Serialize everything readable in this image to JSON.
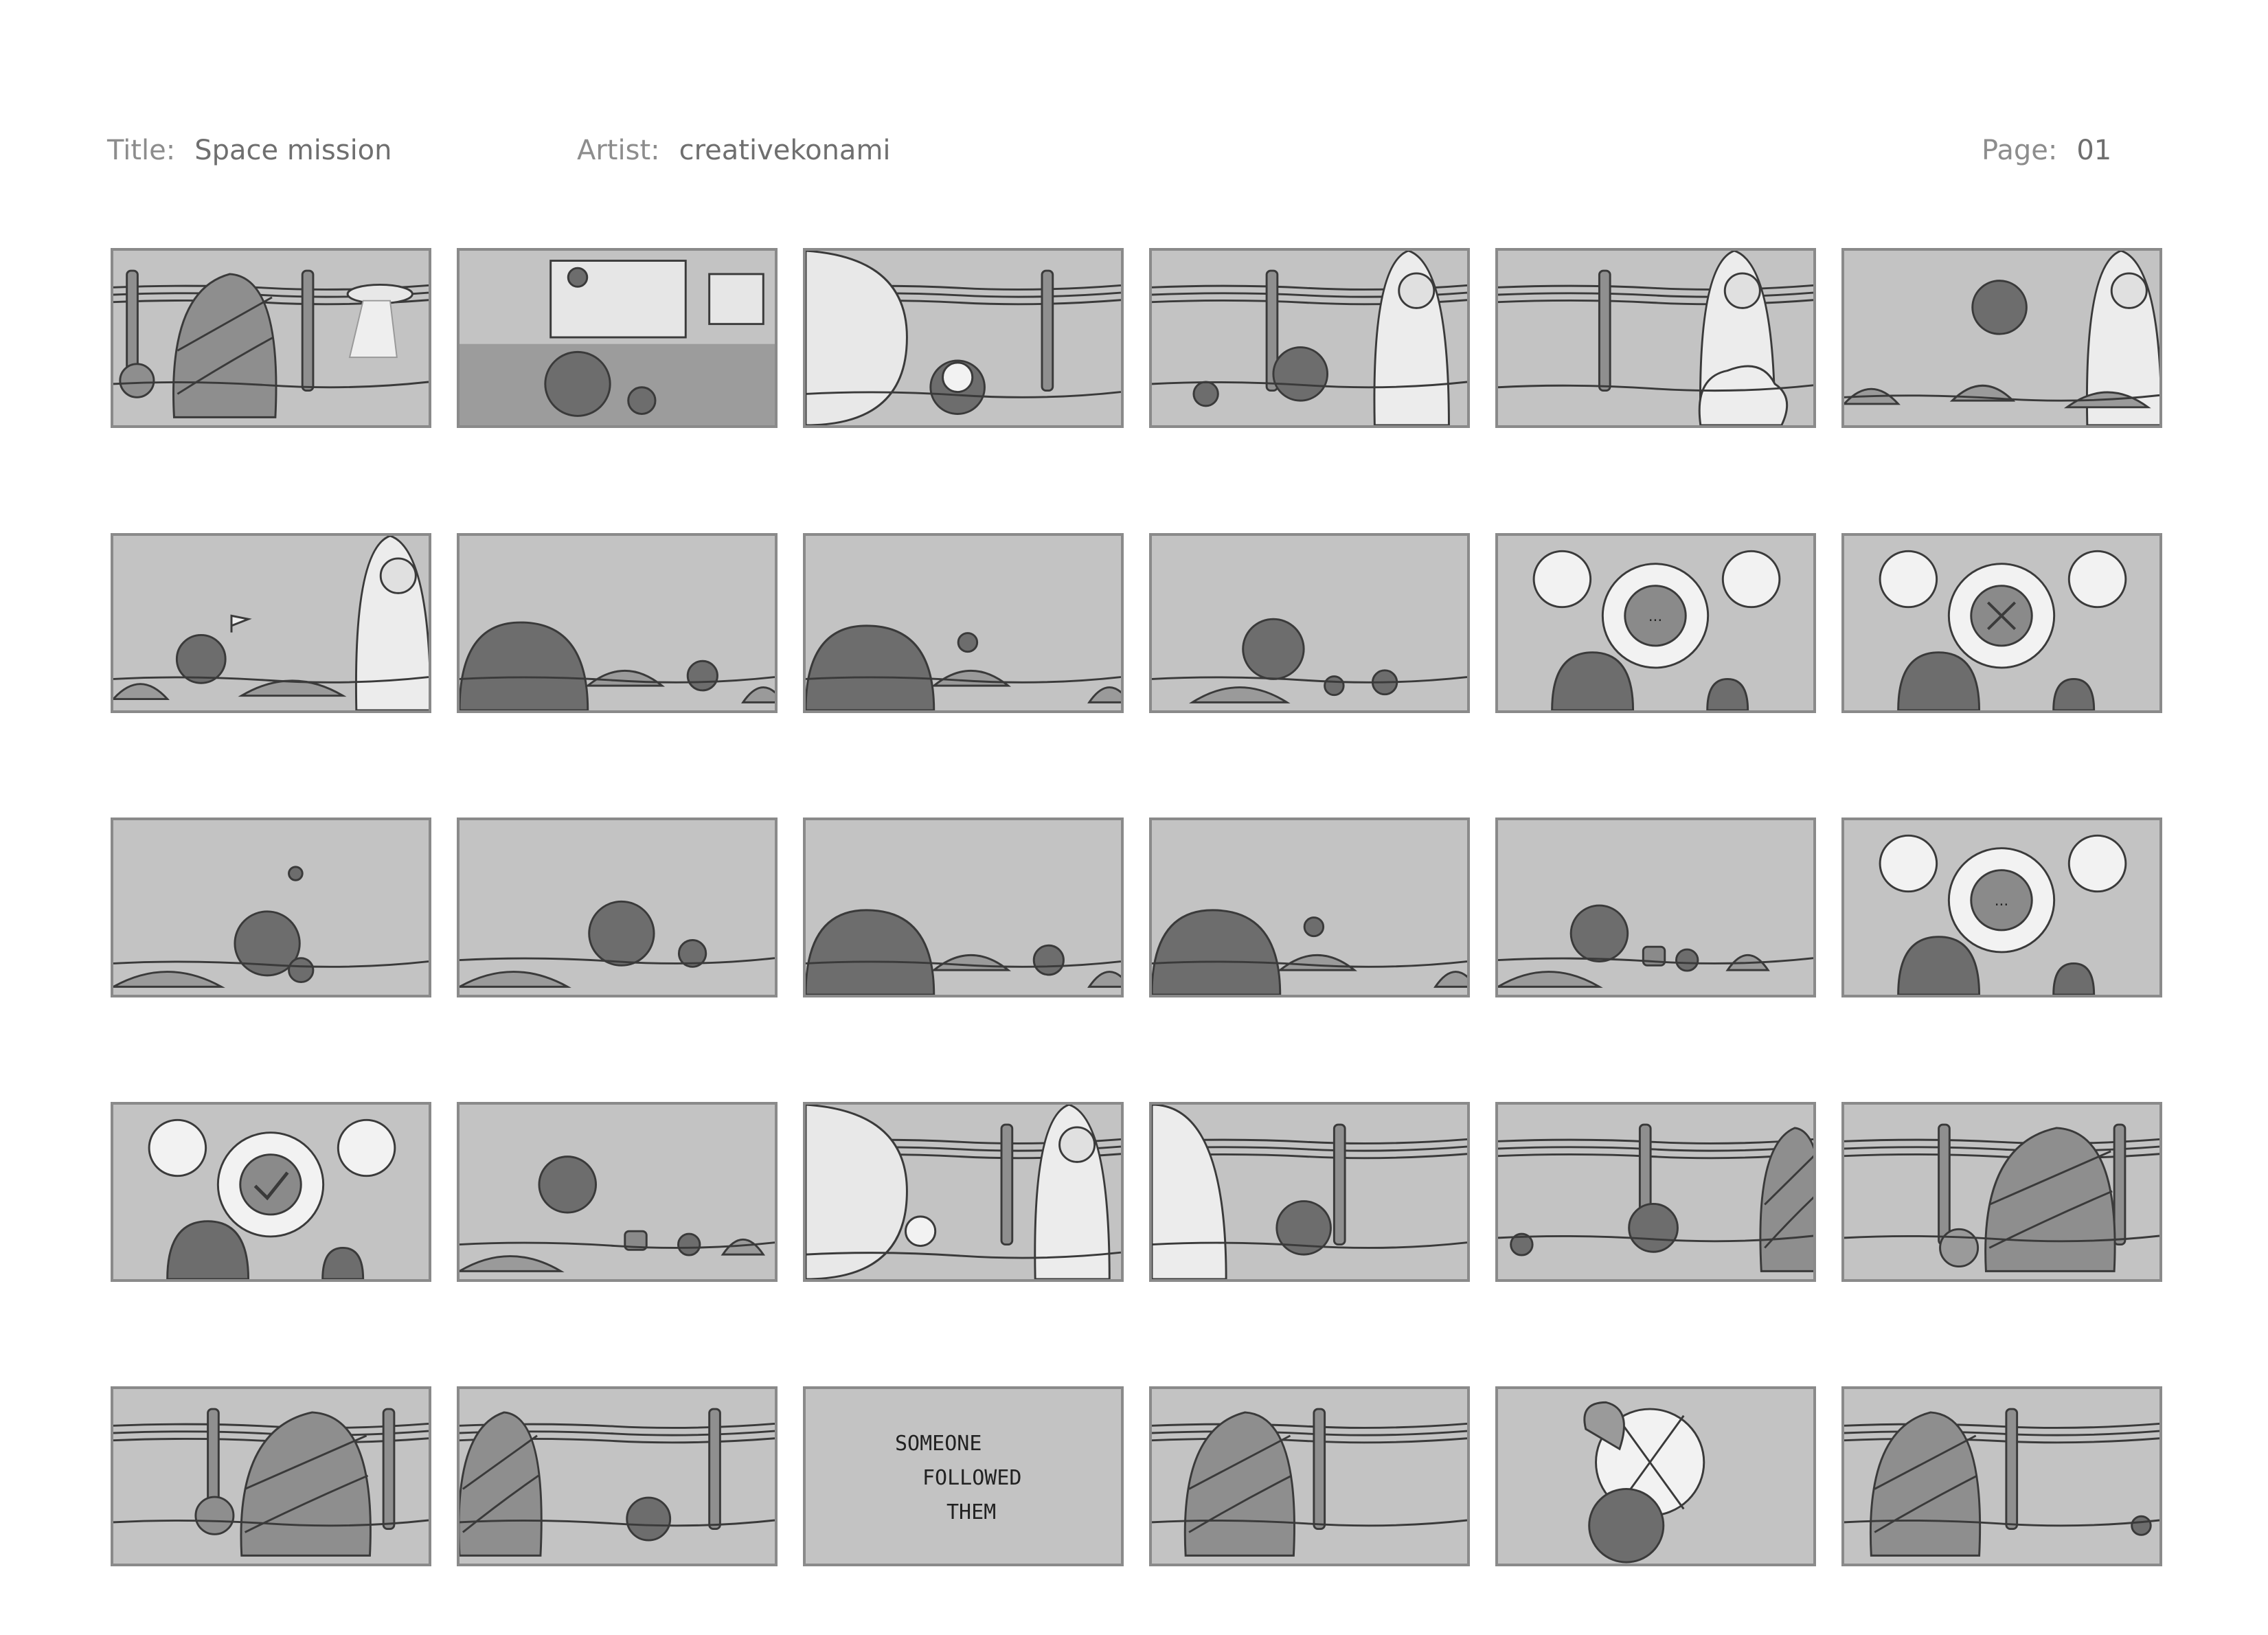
{
  "header": {
    "title_label": "Title:",
    "title_value": "Space mission",
    "artist_label": "Artist:",
    "artist_value": "creativekonami",
    "page_label": "Page:",
    "page_value": "01"
  },
  "panels": [
    {
      "scene": "rock-ufo"
    },
    {
      "scene": "room-tv"
    },
    {
      "scene": "dome-sign"
    },
    {
      "scene": "rocket-fence"
    },
    {
      "scene": "launch-smoke"
    },
    {
      "scene": "floating-character"
    },
    {
      "scene": "flag-planting"
    },
    {
      "scene": "big-creature-closeup"
    },
    {
      "scene": "big-creature-critter"
    },
    {
      "scene": "creature-crabs"
    },
    {
      "scene": "thought-bubbles-ellipsis"
    },
    {
      "scene": "thought-bubbles-cross"
    },
    {
      "scene": "crab-above-creature"
    },
    {
      "scene": "creature-walking"
    },
    {
      "scene": "closeup-ground"
    },
    {
      "scene": "closeup-crab"
    },
    {
      "scene": "creature-jars"
    },
    {
      "scene": "thought-bubbles-jars"
    },
    {
      "scene": "thought-bubbles-check"
    },
    {
      "scene": "creature-jumping"
    },
    {
      "scene": "dome-rocket"
    },
    {
      "scene": "rocket-landing"
    },
    {
      "scene": "fence-ball-rock"
    },
    {
      "scene": "rock-ball"
    },
    {
      "scene": "rock-tree"
    },
    {
      "scene": "rock-icecream"
    },
    {
      "scene": "text-card",
      "caption": [
        "SOMEONE",
        "FOLLOWED",
        "THEM"
      ]
    },
    {
      "scene": "rock-small-icecream"
    },
    {
      "scene": "icecream-frog"
    },
    {
      "scene": "rock-end"
    }
  ]
}
